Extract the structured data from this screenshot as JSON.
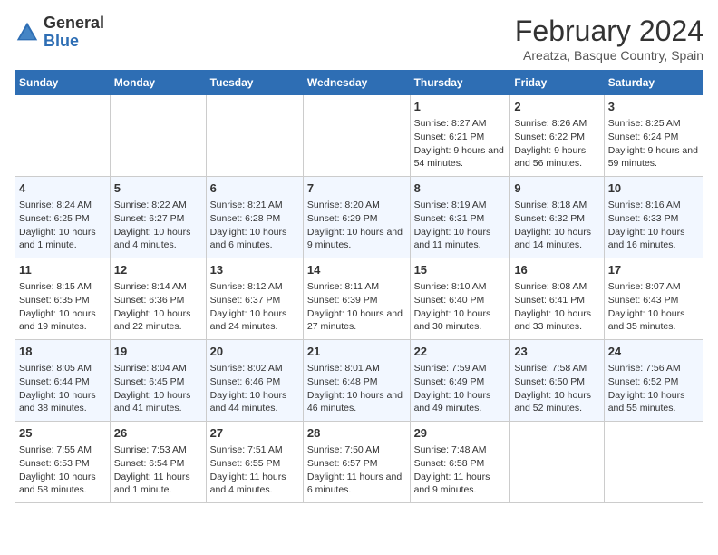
{
  "header": {
    "logo_general": "General",
    "logo_blue": "Blue",
    "title": "February 2024",
    "subtitle": "Areatza, Basque Country, Spain"
  },
  "weekdays": [
    "Sunday",
    "Monday",
    "Tuesday",
    "Wednesday",
    "Thursday",
    "Friday",
    "Saturday"
  ],
  "weeks": [
    [
      {
        "day": "",
        "info": ""
      },
      {
        "day": "",
        "info": ""
      },
      {
        "day": "",
        "info": ""
      },
      {
        "day": "",
        "info": ""
      },
      {
        "day": "1",
        "info": "Sunrise: 8:27 AM\nSunset: 6:21 PM\nDaylight: 9 hours and 54 minutes."
      },
      {
        "day": "2",
        "info": "Sunrise: 8:26 AM\nSunset: 6:22 PM\nDaylight: 9 hours and 56 minutes."
      },
      {
        "day": "3",
        "info": "Sunrise: 8:25 AM\nSunset: 6:24 PM\nDaylight: 9 hours and 59 minutes."
      }
    ],
    [
      {
        "day": "4",
        "info": "Sunrise: 8:24 AM\nSunset: 6:25 PM\nDaylight: 10 hours and 1 minute."
      },
      {
        "day": "5",
        "info": "Sunrise: 8:22 AM\nSunset: 6:27 PM\nDaylight: 10 hours and 4 minutes."
      },
      {
        "day": "6",
        "info": "Sunrise: 8:21 AM\nSunset: 6:28 PM\nDaylight: 10 hours and 6 minutes."
      },
      {
        "day": "7",
        "info": "Sunrise: 8:20 AM\nSunset: 6:29 PM\nDaylight: 10 hours and 9 minutes."
      },
      {
        "day": "8",
        "info": "Sunrise: 8:19 AM\nSunset: 6:31 PM\nDaylight: 10 hours and 11 minutes."
      },
      {
        "day": "9",
        "info": "Sunrise: 8:18 AM\nSunset: 6:32 PM\nDaylight: 10 hours and 14 minutes."
      },
      {
        "day": "10",
        "info": "Sunrise: 8:16 AM\nSunset: 6:33 PM\nDaylight: 10 hours and 16 minutes."
      }
    ],
    [
      {
        "day": "11",
        "info": "Sunrise: 8:15 AM\nSunset: 6:35 PM\nDaylight: 10 hours and 19 minutes."
      },
      {
        "day": "12",
        "info": "Sunrise: 8:14 AM\nSunset: 6:36 PM\nDaylight: 10 hours and 22 minutes."
      },
      {
        "day": "13",
        "info": "Sunrise: 8:12 AM\nSunset: 6:37 PM\nDaylight: 10 hours and 24 minutes."
      },
      {
        "day": "14",
        "info": "Sunrise: 8:11 AM\nSunset: 6:39 PM\nDaylight: 10 hours and 27 minutes."
      },
      {
        "day": "15",
        "info": "Sunrise: 8:10 AM\nSunset: 6:40 PM\nDaylight: 10 hours and 30 minutes."
      },
      {
        "day": "16",
        "info": "Sunrise: 8:08 AM\nSunset: 6:41 PM\nDaylight: 10 hours and 33 minutes."
      },
      {
        "day": "17",
        "info": "Sunrise: 8:07 AM\nSunset: 6:43 PM\nDaylight: 10 hours and 35 minutes."
      }
    ],
    [
      {
        "day": "18",
        "info": "Sunrise: 8:05 AM\nSunset: 6:44 PM\nDaylight: 10 hours and 38 minutes."
      },
      {
        "day": "19",
        "info": "Sunrise: 8:04 AM\nSunset: 6:45 PM\nDaylight: 10 hours and 41 minutes."
      },
      {
        "day": "20",
        "info": "Sunrise: 8:02 AM\nSunset: 6:46 PM\nDaylight: 10 hours and 44 minutes."
      },
      {
        "day": "21",
        "info": "Sunrise: 8:01 AM\nSunset: 6:48 PM\nDaylight: 10 hours and 46 minutes."
      },
      {
        "day": "22",
        "info": "Sunrise: 7:59 AM\nSunset: 6:49 PM\nDaylight: 10 hours and 49 minutes."
      },
      {
        "day": "23",
        "info": "Sunrise: 7:58 AM\nSunset: 6:50 PM\nDaylight: 10 hours and 52 minutes."
      },
      {
        "day": "24",
        "info": "Sunrise: 7:56 AM\nSunset: 6:52 PM\nDaylight: 10 hours and 55 minutes."
      }
    ],
    [
      {
        "day": "25",
        "info": "Sunrise: 7:55 AM\nSunset: 6:53 PM\nDaylight: 10 hours and 58 minutes."
      },
      {
        "day": "26",
        "info": "Sunrise: 7:53 AM\nSunset: 6:54 PM\nDaylight: 11 hours and 1 minute."
      },
      {
        "day": "27",
        "info": "Sunrise: 7:51 AM\nSunset: 6:55 PM\nDaylight: 11 hours and 4 minutes."
      },
      {
        "day": "28",
        "info": "Sunrise: 7:50 AM\nSunset: 6:57 PM\nDaylight: 11 hours and 6 minutes."
      },
      {
        "day": "29",
        "info": "Sunrise: 7:48 AM\nSunset: 6:58 PM\nDaylight: 11 hours and 9 minutes."
      },
      {
        "day": "",
        "info": ""
      },
      {
        "day": "",
        "info": ""
      }
    ]
  ]
}
